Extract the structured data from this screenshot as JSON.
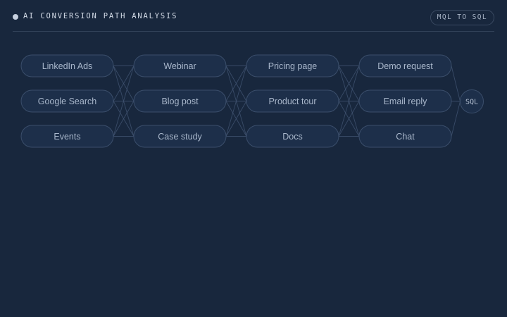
{
  "header": {
    "title": "AI CONVERSION PATH ANALYSIS",
    "badge": "MQL TO SQL"
  },
  "columns": [
    [
      "LinkedIn Ads",
      "Google Search",
      "Events"
    ],
    [
      "Webinar",
      "Blog post",
      "Case study"
    ],
    [
      "Pricing page",
      "Product tour",
      "Docs"
    ],
    [
      "Demo request",
      "Email reply",
      "Chat"
    ]
  ],
  "sink": "SQL",
  "colors": {
    "background": "#18273d",
    "node_fill": "#1d2f4a",
    "node_border": "#3b4e6b",
    "edge": "#3f5270",
    "text": "#a9b7cb"
  }
}
